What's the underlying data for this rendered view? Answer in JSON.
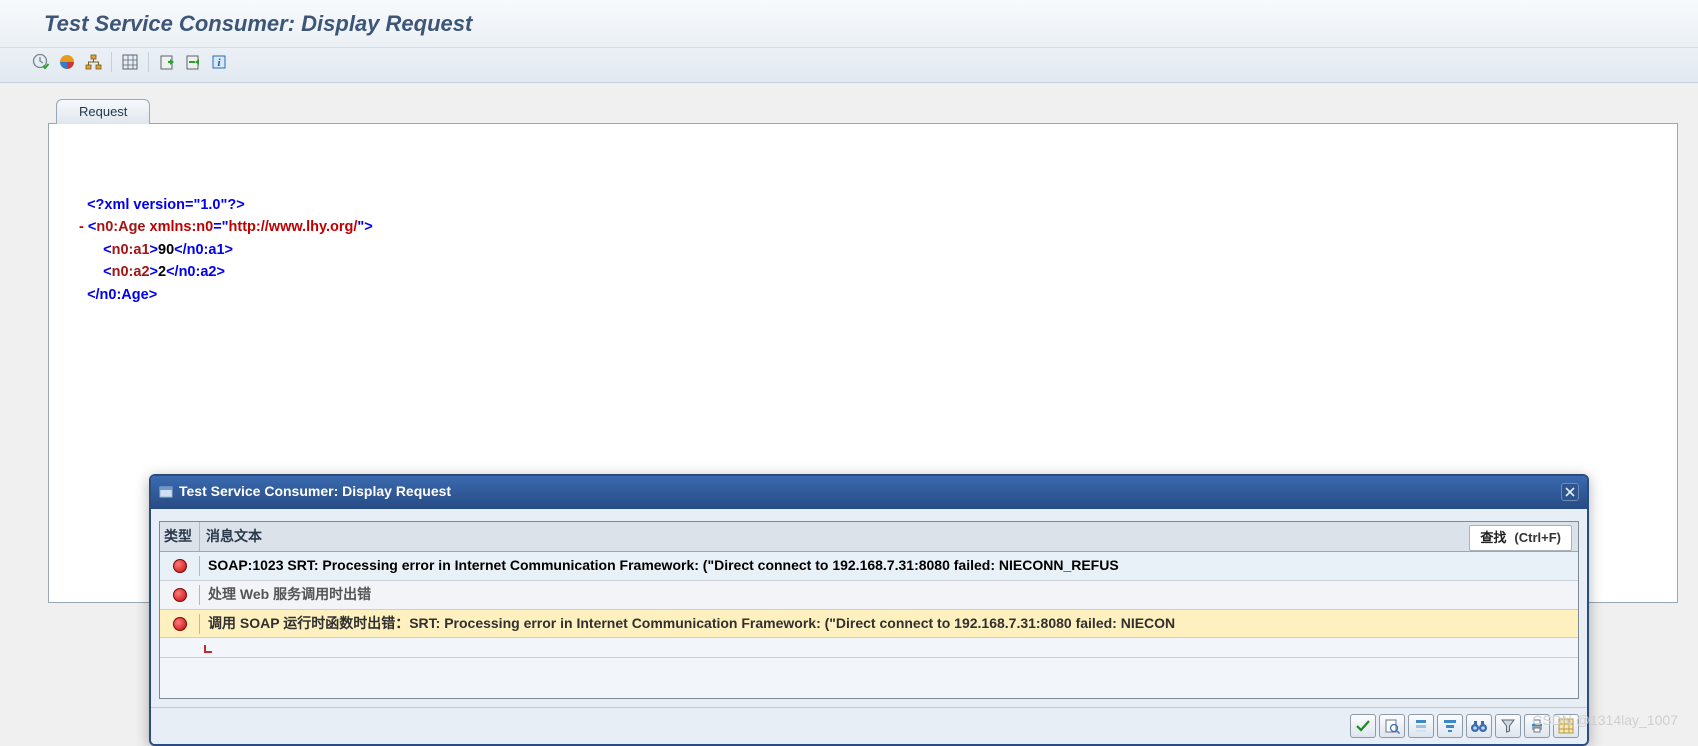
{
  "header": {
    "title": "Test Service Consumer: Display Request"
  },
  "toolbar": {
    "icons": [
      "clock-check",
      "circle-quarters",
      "structure",
      "grid",
      "import",
      "export-green",
      "info-blue"
    ]
  },
  "tabs": {
    "request": "Request"
  },
  "xml": {
    "pi": "<?xml version=\"1.0\"?>",
    "open_angle": "<",
    "age_tag": "n0:Age",
    "xmlns_attr": "xmlns:n0",
    "eq": "=",
    "ns_q": "\"",
    "ns_val": "http://www.lhy.org/",
    "close_angle": ">",
    "a1_tag": "n0:a1",
    "a1_val": "90",
    "a1_close": "</n0:a1>",
    "a2_tag": "n0:a2",
    "a2_val": "2",
    "a2_close": "</n0:a2>",
    "age_close": "</n0:Age>",
    "minus": "-"
  },
  "dialog": {
    "title": "Test Service Consumer: Display Request",
    "col_type": "类型",
    "col_text": "消息文本",
    "find_label": "查找",
    "find_shortcut": "(Ctrl+F)",
    "rows": [
      {
        "kind": "blue",
        "text": "SOAP:1023 SRT: Processing error in Internet Communication Framework: (\"Direct connect to 192.168.7.31:8080 failed: NIECONN_REFUS"
      },
      {
        "kind": "gray",
        "text": "处理 Web 服务调用时出错"
      },
      {
        "kind": "yellow",
        "text": "调用 SOAP 运行时函数时出错：SRT: Processing error in Internet Communication Framework: (\"Direct connect to 192.168.7.31:8080 failed: NIECON"
      }
    ],
    "btn_icons": [
      "check-green",
      "search",
      "sort",
      "align",
      "binoculars",
      "filter",
      "print",
      "grid"
    ]
  },
  "watermark": "CSDN @1314lay_1007"
}
